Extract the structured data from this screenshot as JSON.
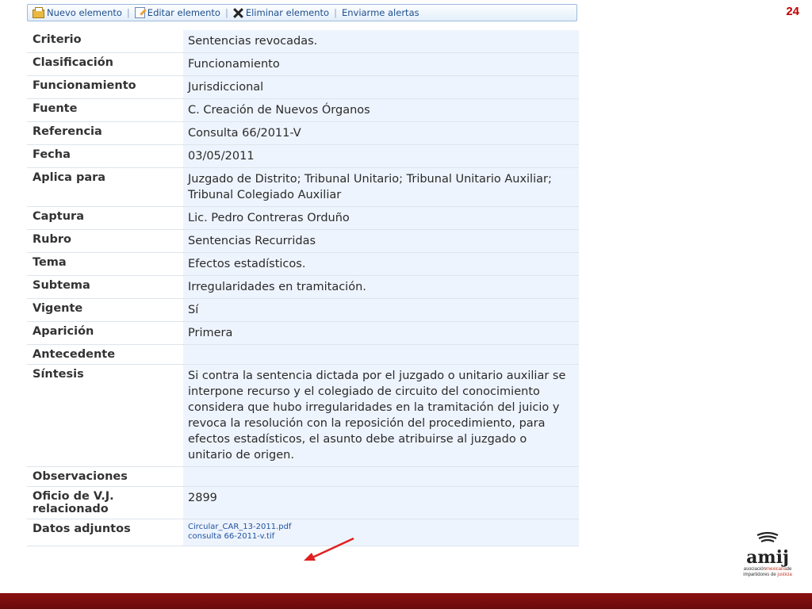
{
  "page_number": "24",
  "toolbar": {
    "new_label": "Nuevo elemento",
    "edit_label": "Editar elemento",
    "delete_label": "Eliminar elemento",
    "alerts_label": "Enviarme alertas",
    "separator": "|"
  },
  "fields": [
    {
      "label": "Criterio",
      "value": "Sentencias revocadas."
    },
    {
      "label": "Clasificación",
      "value": "Funcionamiento"
    },
    {
      "label": "Funcionamiento",
      "value": "Jurisdiccional"
    },
    {
      "label": "Fuente",
      "value": "C. Creación de Nuevos Órganos"
    },
    {
      "label": "Referencia",
      "value": "Consulta 66/2011-V"
    },
    {
      "label": "Fecha",
      "value": "03/05/2011"
    },
    {
      "label": "Aplica para",
      "value": "Juzgado de Distrito; Tribunal Unitario; Tribunal Unitario Auxiliar; Tribunal Colegiado Auxiliar"
    },
    {
      "label": "Captura",
      "value": "Lic. Pedro Contreras Orduño"
    },
    {
      "label": "Rubro",
      "value": "Sentencias Recurridas"
    },
    {
      "label": "Tema",
      "value": "Efectos estadísticos."
    },
    {
      "label": "Subtema",
      "value": "Irregularidades en tramitación."
    },
    {
      "label": "Vigente",
      "value": "Sí"
    },
    {
      "label": "Aparición",
      "value": "Primera"
    },
    {
      "label": "Antecedente",
      "value": ""
    },
    {
      "label": "Síntesis",
      "value": "Si contra la sentencia dictada por el juzgado o unitario auxiliar se interpone recurso y el colegiado de circuito del conocimiento considera que hubo irregularidades en la tramitación del juicio y revoca la resolución con la reposición del procedimiento, para efectos estadísticos, el asunto debe atribuirse al juzgado o unitario de origen."
    },
    {
      "label": "Observaciones",
      "value": ""
    },
    {
      "label": "Oficio de V.J. relacionado",
      "value": "2899"
    }
  ],
  "attachments": {
    "label": "Datos adjuntos",
    "files": [
      "Circular_CAR_13-2011.pdf",
      "consulta 66-2011-v.tif"
    ]
  },
  "logo": {
    "name": "amij",
    "tag_part1": "asociación",
    "tag_accent": "mexicana",
    "tag_part2": "de",
    "tag_part3": "impartidores",
    "tag_part4": "de",
    "tag_accent2": "justicia"
  },
  "colors": {
    "page_number": "#c00000",
    "footer_bar": "#7a0d0d",
    "arrow": "#e02020",
    "link": "#1f52a1",
    "value_bg": "#eef4fd"
  }
}
